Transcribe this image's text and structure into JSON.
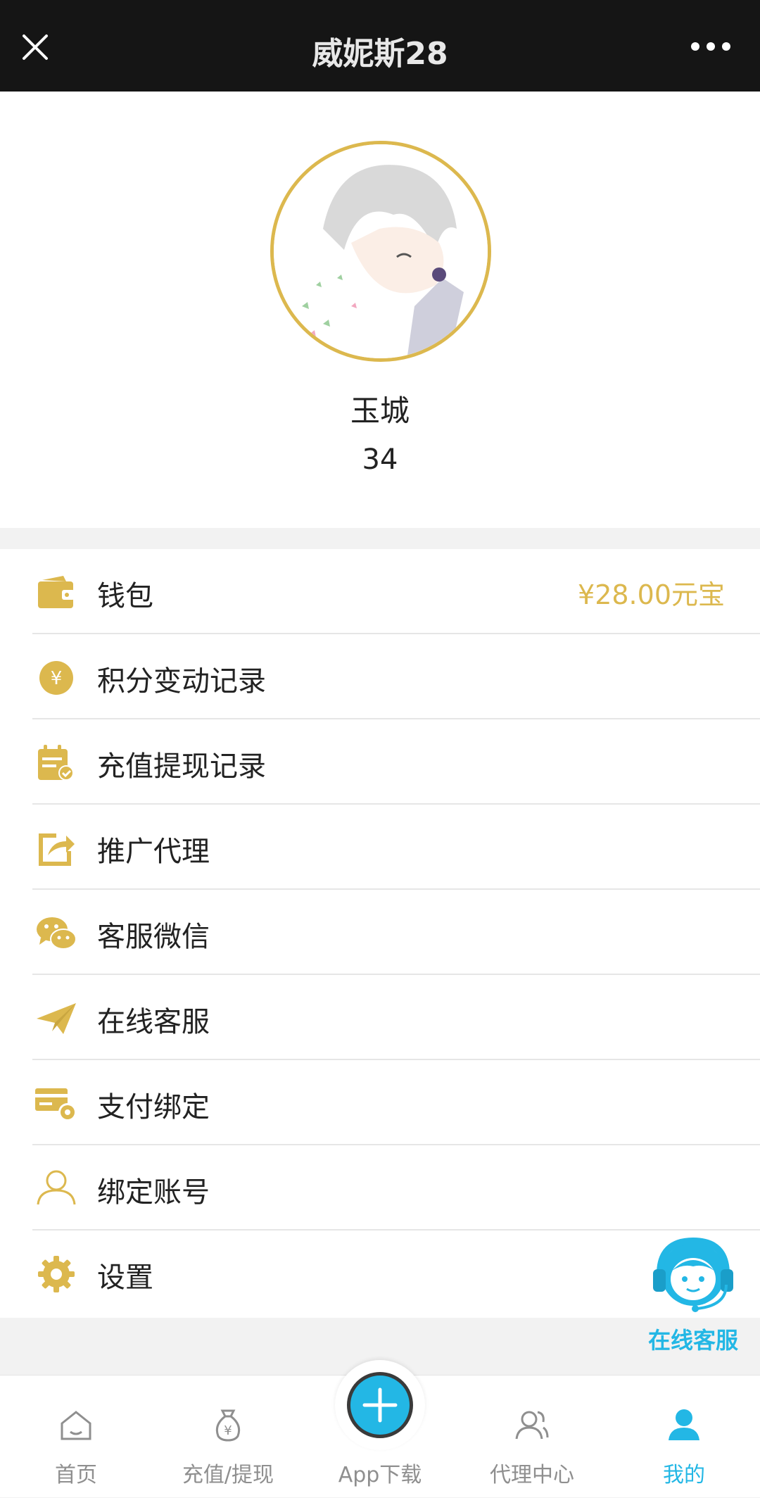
{
  "topbar": {
    "title": "威妮斯28"
  },
  "profile": {
    "name": "玉城",
    "id": "34"
  },
  "menu": {
    "items": [
      {
        "label": "钱包",
        "value": "¥28.00元宝",
        "icon": "wallet-icon"
      },
      {
        "label": "积分变动记录",
        "icon": "yuan-coin-icon"
      },
      {
        "label": "充值提现记录",
        "icon": "calendar-check-icon"
      },
      {
        "label": "推广代理",
        "icon": "share-icon"
      },
      {
        "label": "客服微信",
        "icon": "wechat-icon"
      },
      {
        "label": "在线客服",
        "icon": "paper-plane-icon"
      },
      {
        "label": "支付绑定",
        "icon": "card-gear-icon"
      },
      {
        "label": "绑定账号",
        "icon": "user-icon"
      },
      {
        "label": "设置",
        "icon": "gear-icon"
      }
    ]
  },
  "float_service": {
    "label": "在线客服"
  },
  "tabbar": {
    "home": "首页",
    "recharge": "充值/提现",
    "app": "App下载",
    "agent": "代理中心",
    "mine": "我的"
  },
  "colors": {
    "accent_gold": "#dcb84e",
    "accent_blue": "#23b7e5",
    "topbar_bg": "#151515"
  }
}
